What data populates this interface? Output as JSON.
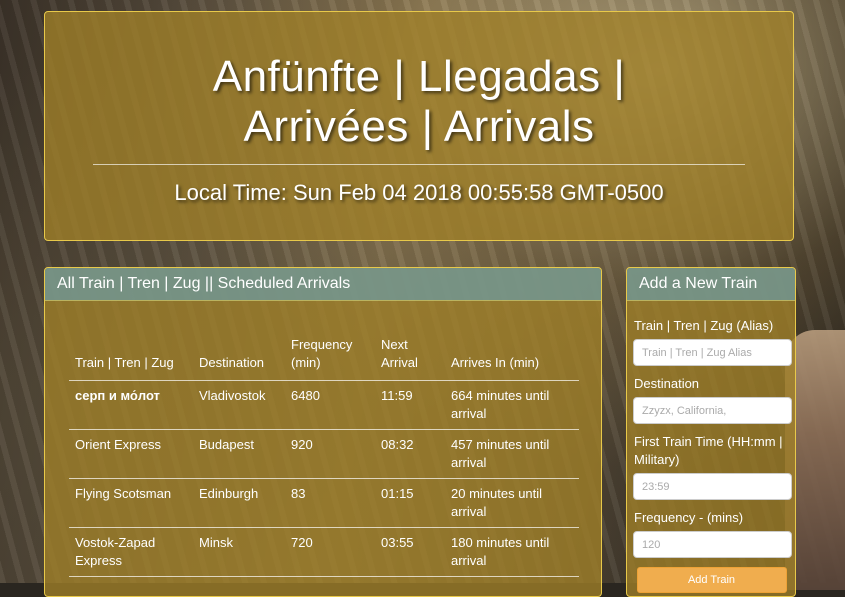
{
  "header": {
    "title": "Anfünfte | Llegadas | Arrivées | Arrivals",
    "local_time": "Local Time: Sun Feb 04 2018 00:55:58 GMT-0500"
  },
  "schedule": {
    "heading": "All Train | Tren | Zug || Scheduled Arrivals",
    "columns": [
      "Train | Tren | Zug",
      "Destination",
      "Frequency (min)",
      "Next Arrival",
      "Arrives In (min)"
    ],
    "rows": [
      {
        "train": "серп и мо́лот",
        "destination": "Vladivostok",
        "frequency": "6480",
        "next": "11:59",
        "arrives_in": "664 minutes until arrival"
      },
      {
        "train": "Orient Express",
        "destination": "Budapest",
        "frequency": "920",
        "next": "08:32",
        "arrives_in": "457 minutes until arrival"
      },
      {
        "train": "Flying Scotsman",
        "destination": "Edinburgh",
        "frequency": "83",
        "next": "01:15",
        "arrives_in": "20 minutes until arrival"
      },
      {
        "train": "Vostok-Zapad Express",
        "destination": "Minsk",
        "frequency": "720",
        "next": "03:55",
        "arrives_in": "180 minutes until arrival"
      }
    ]
  },
  "add_train": {
    "heading": "Add a New Train",
    "name_label": "Train | Tren | Zug (Alias)",
    "name_placeholder": "Train | Tren | Zug Alias",
    "destination_label": "Destination",
    "destination_placeholder": "Zzyzx, California,",
    "first_time_label": "First Train Time (HH:mm | Military)",
    "first_time_placeholder": "23:59",
    "frequency_label": "Frequency - (mins)",
    "frequency_placeholder": "120",
    "submit_label": "Add Train"
  }
}
